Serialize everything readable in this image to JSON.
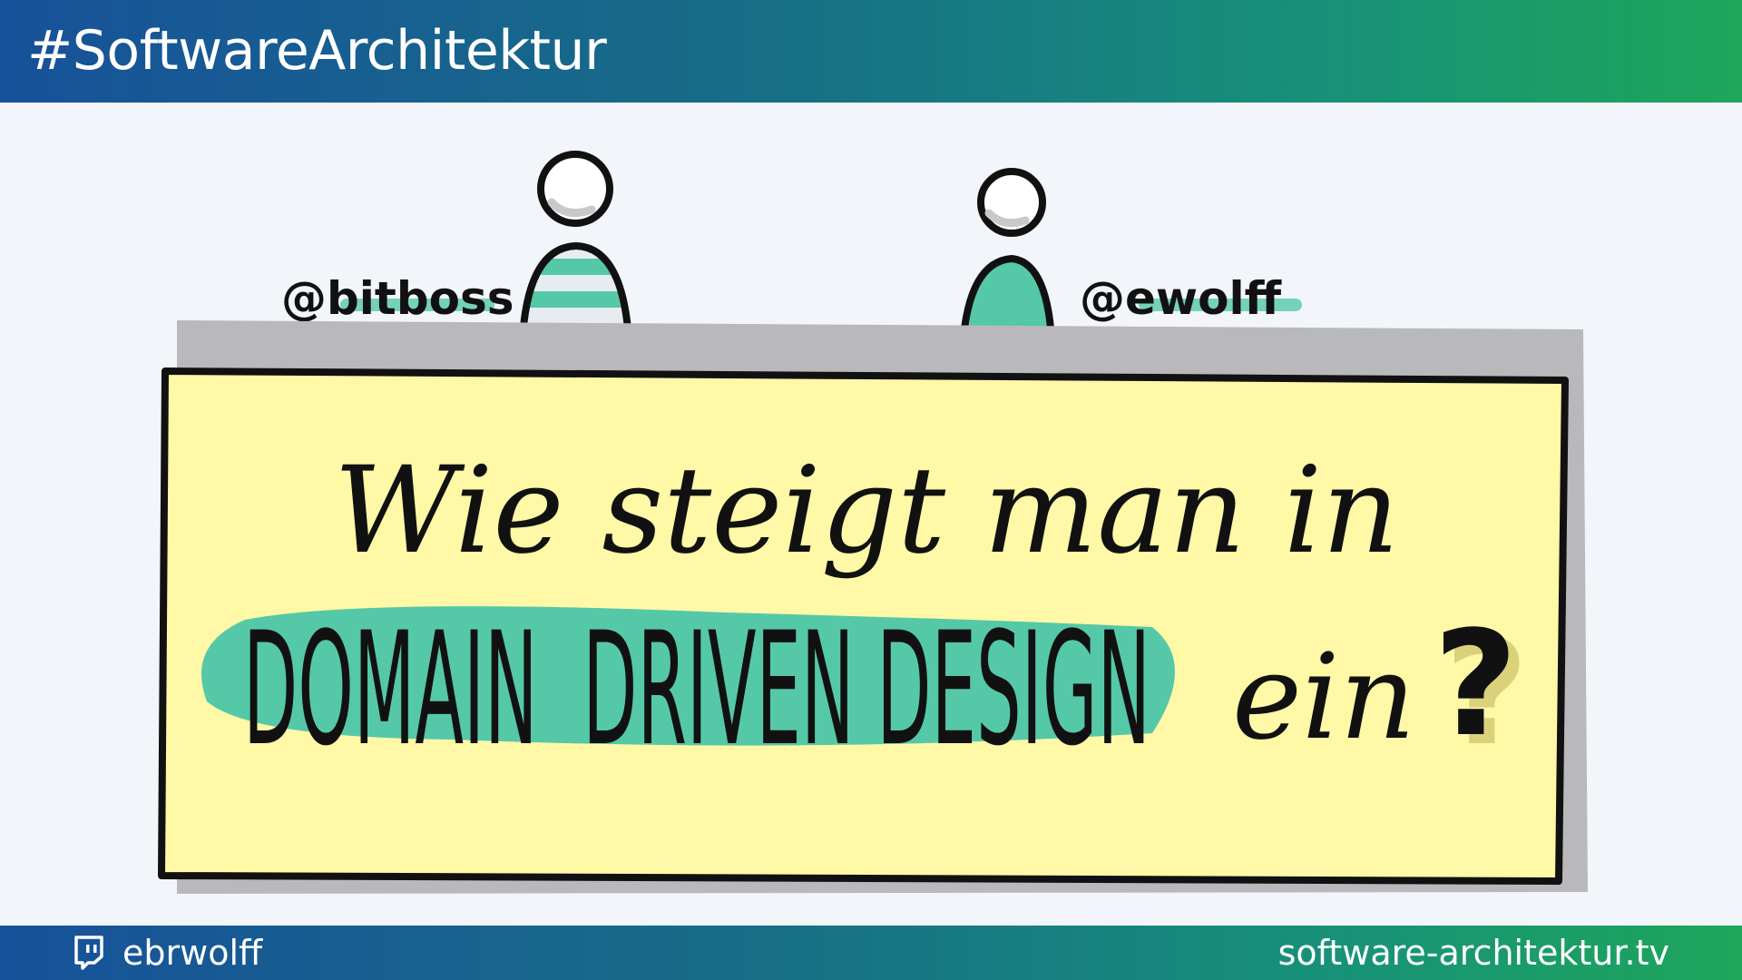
{
  "header": {
    "hashtag": "#SoftwareArchitektur"
  },
  "speakers": {
    "left_handle": "@bitboss",
    "right_handle": "@ewolff"
  },
  "title": {
    "line1": "Wie steigt man in",
    "highlight": "DOMAIN  DRIVEN DESIGN",
    "line2_suffix": "ein",
    "question_mark": "?"
  },
  "footer": {
    "twitch_handle": "ebrwolff",
    "website": "software-architektur.tv"
  },
  "colors": {
    "accent_teal": "#55c8a8",
    "board_yellow": "#fff8a6",
    "header_blue": "#17519a",
    "header_green": "#1ea65a"
  },
  "icons": {
    "footer_icon": "twitch-icon"
  }
}
